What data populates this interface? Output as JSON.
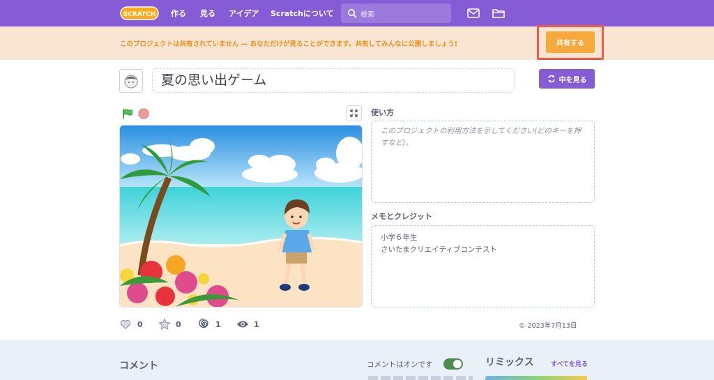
{
  "nav": {
    "logo_text": "SCRATCH",
    "links": [
      "作る",
      "見る",
      "アイデア",
      "Scratchについて"
    ],
    "search_placeholder": "検索"
  },
  "banner": {
    "message": "このプロジェクトは共有されていません — あなただけが見ることができます。共有してみんなに公開しましょう!",
    "share_label": "共有する"
  },
  "project": {
    "title": "夏の思い出ゲーム",
    "see_inside_label": "中を見る"
  },
  "stats": {
    "loves": "0",
    "favorites": "0",
    "remixes": "1",
    "views": "1",
    "date": "2023年7月13日"
  },
  "instructions": {
    "label": "使い方",
    "placeholder": "このプロジェクトの利用方法を示してください(どのキーを押すなど)。"
  },
  "notes": {
    "label": "メモとクレジット",
    "lines": [
      "小学６年生",
      "さいたまクリエイティブコンテスト"
    ]
  },
  "comments": {
    "title": "コメント",
    "toggle_label": "コメントはオンです",
    "toggle_on": true
  },
  "remix": {
    "title": "リミックス",
    "see_all": "すべてを見る"
  },
  "colors": {
    "nav": "#855cd6",
    "banner_bg": "#f9e6d2",
    "banner_text": "#f28f1e",
    "share_button": "#f8a93b",
    "highlight": "#f05a4a",
    "accent": "#855cd6",
    "toggle_on": "#4f8a4f"
  },
  "icons": [
    "search-icon",
    "mail-icon",
    "folder-icon",
    "green-flag-icon",
    "stop-icon",
    "fullscreen-icon",
    "remix-icon",
    "heart-icon",
    "star-icon",
    "spiral-icon",
    "eye-icon",
    "copyright-icon"
  ]
}
